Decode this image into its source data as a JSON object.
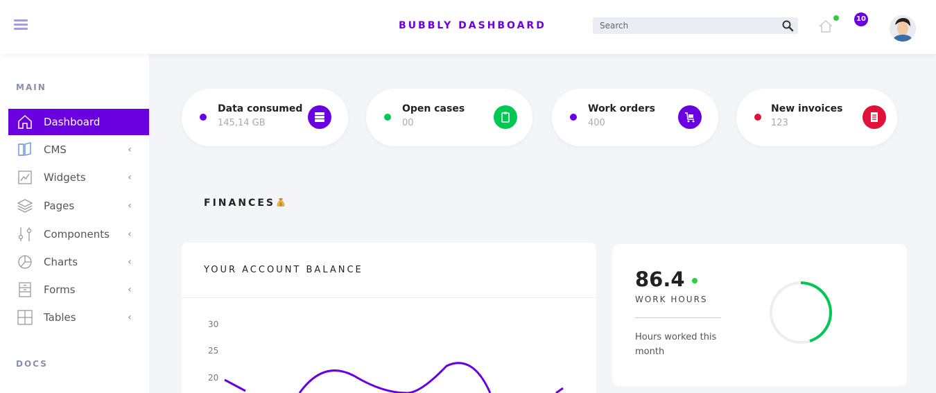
{
  "header": {
    "brand": "BUBBLY DASHBOARD",
    "search_placeholder": "Search",
    "notifications_count": "10",
    "accent_color": "#6a00e0"
  },
  "sidebar": {
    "sections": [
      "MAIN",
      "DOCS"
    ],
    "items": [
      {
        "label": "Dashboard",
        "icon": "home-icon",
        "active": true
      },
      {
        "label": "CMS",
        "icon": "book-icon"
      },
      {
        "label": "Widgets",
        "icon": "chart-line-icon"
      },
      {
        "label": "Pages",
        "icon": "layers-icon"
      },
      {
        "label": "Components",
        "icon": "sliders-icon"
      },
      {
        "label": "Charts",
        "icon": "pie-chart-icon"
      },
      {
        "label": "Forms",
        "icon": "cabinet-icon"
      },
      {
        "label": "Tables",
        "icon": "grid-icon"
      }
    ]
  },
  "stats": [
    {
      "title": "Data consumed",
      "value": "145,14 GB",
      "dot_color": "#6a00e0",
      "icon": "server-icon",
      "icon_color": "#6a00e0"
    },
    {
      "title": "Open cases",
      "value": "00",
      "dot_color": "#00c853",
      "icon": "clipboard-icon",
      "icon_color": "#00c853"
    },
    {
      "title": "Work orders",
      "value": "400",
      "dot_color": "#6a00e0",
      "icon": "cart-icon",
      "icon_color": "#6a00e0"
    },
    {
      "title": "New invoices",
      "value": "123",
      "dot_color": "#e0123a",
      "icon": "receipt-icon",
      "icon_color": "#e0123a"
    }
  ],
  "finances": {
    "title": "FINANCES",
    "icon": "money-bag-icon",
    "balance_title": "YOUR ACCOUNT BALANCE",
    "y_ticks": [
      "30",
      "25",
      "20"
    ],
    "work_hours_value": "86.4",
    "work_hours_label": "WORK HOURS",
    "work_hours_desc": "Hours worked this month",
    "work_hours_progress": 0.45,
    "ring_color": "#00c853"
  }
}
